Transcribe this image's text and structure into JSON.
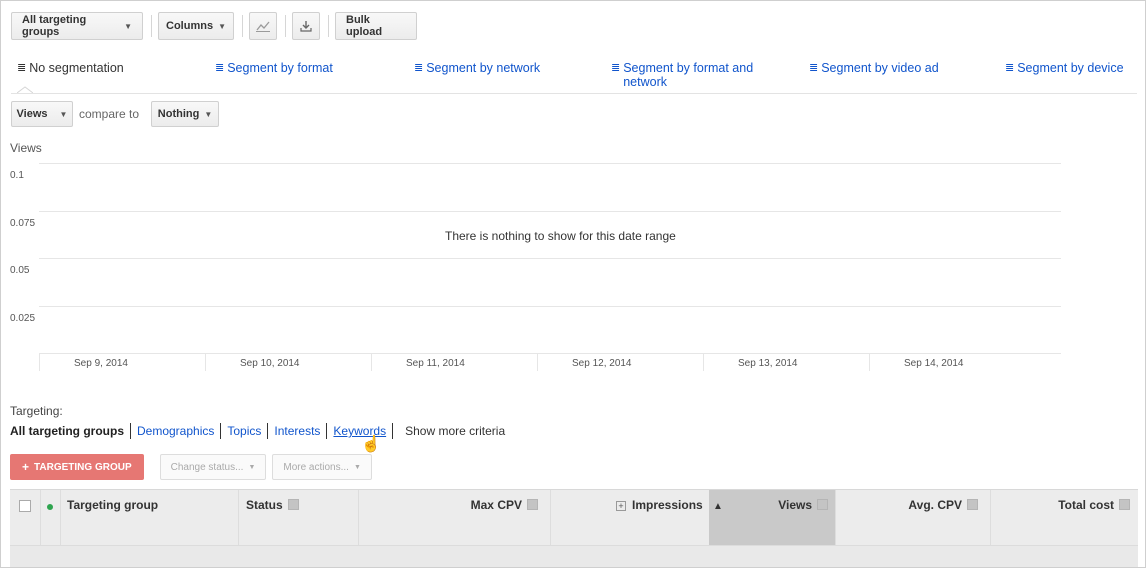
{
  "toolbar": {
    "targeting_groups_label": "All targeting groups",
    "columns_label": "Columns",
    "bulk_upload_label": "Bulk upload"
  },
  "segments": {
    "none": "No segmentation",
    "format": "Segment by format",
    "network": "Segment by network",
    "format_network": "Segment by format and network",
    "video_ad": "Segment by video ad",
    "device": "Segment by device"
  },
  "metric": {
    "selected": "Views",
    "compare_label": "compare to",
    "compare_selected": "Nothing"
  },
  "chart_data": {
    "type": "line",
    "ylabel": "Views",
    "yticks": [
      "0.1",
      "0.075",
      "0.05",
      "0.025"
    ],
    "ylim": [
      0,
      0.1
    ],
    "categories": [
      "Sep 9, 2014",
      "Sep 10, 2014",
      "Sep 11, 2014",
      "Sep 12, 2014",
      "Sep 13, 2014",
      "Sep 14, 2014"
    ],
    "series": [],
    "grid": true,
    "empty_message": "There is nothing to show for this date range"
  },
  "targeting": {
    "label": "Targeting:",
    "tabs": [
      "All targeting groups",
      "Demographics",
      "Topics",
      "Interests",
      "Keywords"
    ],
    "more": "Show more criteria"
  },
  "actions": {
    "add_label": "TARGETING GROUP",
    "change_status": "Change status...",
    "more_actions": "More actions..."
  },
  "table": {
    "columns": [
      "Targeting group",
      "Status",
      "Max CPV",
      "Impressions",
      "Views",
      "Avg. CPV",
      "Total cost"
    ]
  },
  "colors": {
    "link": "#1155cc",
    "add_button": "#e67773",
    "status_dot": "#2ea44f",
    "sorted_column": "#c9c9c9"
  }
}
